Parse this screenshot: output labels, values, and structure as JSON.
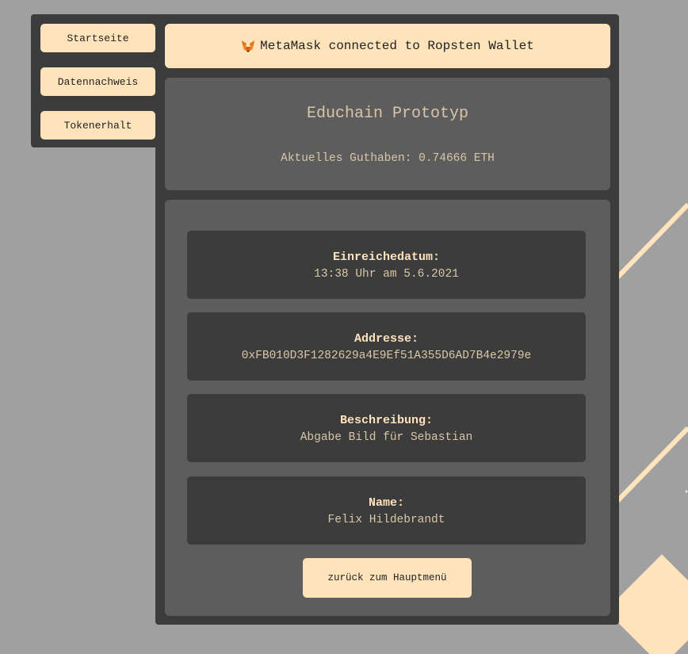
{
  "nav": {
    "items": [
      {
        "label": "Startseite"
      },
      {
        "label": "Datennachweis"
      },
      {
        "label": "Tokenerhalt"
      }
    ]
  },
  "status": {
    "icon": "metamask-fox-icon",
    "text": "MetaMask connected to Ropsten Wallet"
  },
  "header": {
    "title": "Educhain Prototyp",
    "balance": "Aktuelles Guthaben: 0.74666 ETH"
  },
  "details": [
    {
      "label": "Einreichedatum:",
      "value": "13:38 Uhr am 5.6.2021"
    },
    {
      "label": "Addresse:",
      "value": "0xFB010D3F1282629a4E9Ef51A355D6AD7B4e2979e"
    },
    {
      "label": "Beschreibung:",
      "value": "Abgabe Bild für Sebastian"
    },
    {
      "label": "Name:",
      "value": "Felix Hildebrandt"
    }
  ],
  "actions": {
    "back_label": "zurück zum Hauptmenü"
  },
  "colors": {
    "background": "#a0a0a0",
    "panel_dark": "#3c3c3c",
    "panel_mid": "#5d5d5d",
    "accent": "#ffe3bb",
    "muted_text": "#d9c6a8"
  }
}
